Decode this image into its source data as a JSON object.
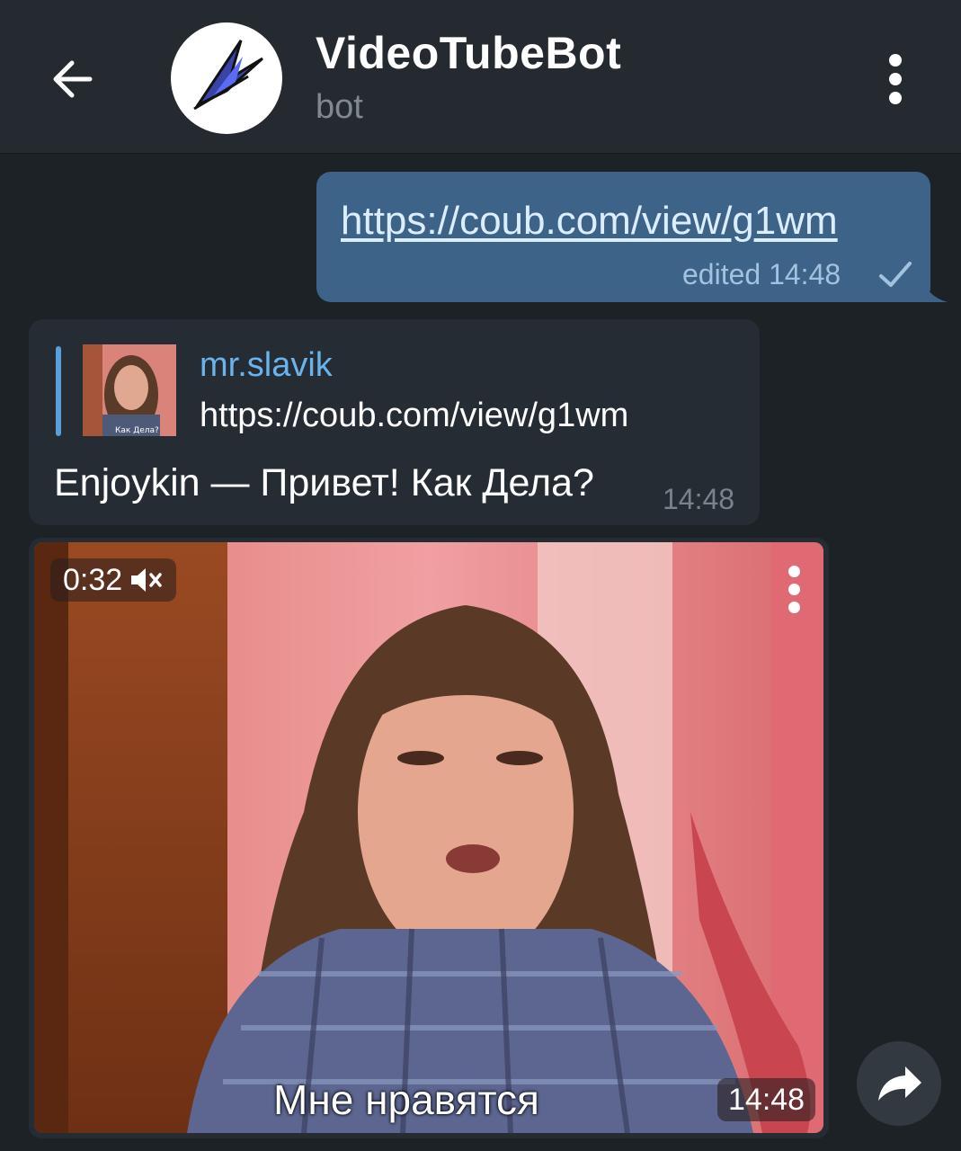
{
  "header": {
    "title": "VideoTubeBot",
    "subtitle": "bot",
    "icons": [
      "back-arrow-icon",
      "bot-avatar-logo",
      "more-vert-icon"
    ]
  },
  "messages": {
    "outgoing": {
      "link": "https://coub.com/view/g1wm",
      "meta": "edited 14:48",
      "status_icon": "single-check-icon"
    },
    "incoming": {
      "reply_name": "mr.slavik",
      "reply_text": "https://coub.com/view/g1wm",
      "reply_thumb_caption": "Как Дела?",
      "text": "Enjoykin — Привет! Как Дела?",
      "time": "14:48"
    },
    "video": {
      "duration": "0:32",
      "muted_icon": "volume-muted-icon",
      "caption": "Мне нравятся",
      "time": "14:48"
    }
  },
  "actions": {
    "share_icon": "share-forward-icon"
  },
  "colors": {
    "background": "#1d2227",
    "header": "#242a30",
    "outgoing_bubble": "#3d6389",
    "incoming_bubble": "#262c33",
    "accent": "#6ab3ec"
  }
}
